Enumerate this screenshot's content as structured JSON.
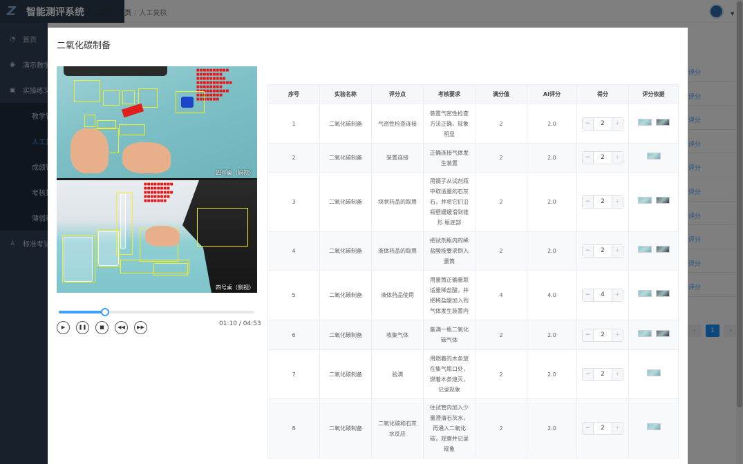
{
  "app": {
    "title": "智能测评系统",
    "logo": "Z"
  },
  "sidebar": {
    "items": [
      {
        "label": "首页",
        "icon": "dashboard-icon"
      },
      {
        "label": "演示教学",
        "icon": "eye-icon"
      },
      {
        "label": "实操练习",
        "icon": "practice-icon"
      }
    ],
    "subitems": [
      {
        "label": "教学管理",
        "active": false
      },
      {
        "label": "人工复核",
        "active": true
      },
      {
        "label": "成绩管理",
        "active": false
      },
      {
        "label": "考核报告",
        "active": false
      },
      {
        "label": "薄弱环节",
        "active": false
      }
    ],
    "bottom": {
      "label": "标准考试",
      "icon": "exam-icon"
    }
  },
  "breadcrumb": {
    "home": "首页",
    "separator": "/",
    "current": "人工复核"
  },
  "background": {
    "right_links": [
      "评分",
      "评分",
      "评分",
      "评分",
      "评分",
      "评分",
      "评分",
      "评分",
      "评分",
      "评分"
    ],
    "pager": {
      "prev": "‹",
      "page": "1",
      "next": "›"
    }
  },
  "dialog": {
    "title": "二氧化碳制备",
    "video": {
      "camera1_label": "四号桌（俯视）",
      "camera2_label": "四号桌（侧视）",
      "progress": 0.235,
      "time": "01:10 / 04:53",
      "controls": [
        "play-icon",
        "pause-icon",
        "stop-icon",
        "prev-icon",
        "next-icon"
      ]
    },
    "table": {
      "headers": [
        "序号",
        "实验名称",
        "评分点",
        "考核要求",
        "满分值",
        "AI评分",
        "得分",
        "评分依据"
      ],
      "rows": [
        {
          "no": "1",
          "name": "二氧化碳制备",
          "point": "气密性检查连接",
          "req": "装置气密性检查方法正确，现象明显",
          "full": "2",
          "ai": "2.0",
          "score": "2",
          "evidence": 2
        },
        {
          "no": "2",
          "name": "二氧化碳制备",
          "point": "装置连接",
          "req": "正确连接气体发生装置",
          "full": "2",
          "ai": "2.0",
          "score": "2",
          "evidence": 1
        },
        {
          "no": "3",
          "name": "二氧化碳制备",
          "point": "块状药品的取用",
          "req": "用镊子从试剂瓶中取适量的石灰石，并将它们沿瓶壁缓缓滑到锥形 瓶底部",
          "full": "2",
          "ai": "2.0",
          "score": "2",
          "evidence": 2
        },
        {
          "no": "4",
          "name": "二氧化碳制备",
          "point": "液体药品的取用",
          "req": "把试剂瓶内的稀盐酸按要求倒入量筒",
          "full": "2",
          "ai": "2.0",
          "score": "2",
          "evidence": 2
        },
        {
          "no": "5",
          "name": "二氧化碳制备",
          "point": "液体药品使用",
          "req": "用量筒正确量取适量稀盐酸，并把稀盐酸加入到气体发生装置内",
          "full": "4",
          "ai": "4.0",
          "score": "4",
          "evidence": 2
        },
        {
          "no": "6",
          "name": "二氧化碳制备",
          "point": "收集气体",
          "req": "集满一瓶二氧化碳气体",
          "full": "2",
          "ai": "2.0",
          "score": "2",
          "evidence": 2
        },
        {
          "no": "7",
          "name": "二氧化碳制备",
          "point": "验满",
          "req": "用燃着的木条放在集气瓶口处，燃着木条熄灭，记录现象",
          "full": "2",
          "ai": "2.0",
          "score": "2",
          "evidence": 1
        },
        {
          "no": "8",
          "name": "二氧化碳制备",
          "point": "二氧化碳和石灰水反应",
          "req": "往试管内加入少量澄清石灰水，再通入二氧化碳，观察并记录现象",
          "full": "2",
          "ai": "2.0",
          "score": "2",
          "evidence": 1
        }
      ]
    }
  },
  "colors": {
    "sidebar": "#304156",
    "accent": "#409eff"
  }
}
